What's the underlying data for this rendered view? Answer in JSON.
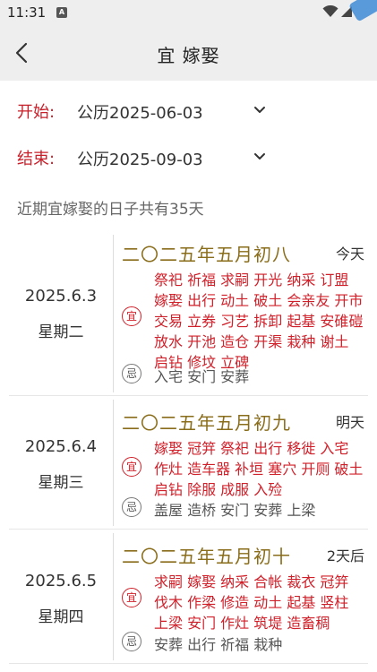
{
  "status_bar": {
    "time": "11:31",
    "notification_glyph": "A"
  },
  "app_bar": {
    "title": "宜 嫁娶"
  },
  "range": {
    "start_label": "开始:",
    "start_value": "公历2025-06-03",
    "end_label": "结束:",
    "end_value": "公历2025-09-03"
  },
  "summary": "近期宜嫁娶的日子共有35天",
  "days": [
    {
      "date": "2025.6.3",
      "weekday": "星期二",
      "lunar": "二〇二五年五月初八",
      "relative": "今天",
      "yi_badge": "宜",
      "yi": "祭祀 祈福 求嗣 开光 纳采 订盟 嫁娶 出行 动土 破土 会亲友 开市 交易 立券 习艺 拆卸 起基 安碓磑 放水 开池 造仓 开渠 栽种 谢土 启钻 修坟 立碑",
      "ji_badge": "忌",
      "ji": "入宅 安门 安葬"
    },
    {
      "date": "2025.6.4",
      "weekday": "星期三",
      "lunar": "二〇二五年五月初九",
      "relative": "明天",
      "yi_badge": "宜",
      "yi": "嫁娶 冠笄 祭祀 出行 移徙 入宅 作灶 造车器 补垣 塞穴 开厕 破土 启钻 除服 成服 入殓",
      "ji_badge": "忌",
      "ji": "盖屋 造桥 安门 安葬 上梁"
    },
    {
      "date": "2025.6.5",
      "weekday": "星期四",
      "lunar": "二〇二五年五月初十",
      "relative": "2天后",
      "yi_badge": "宜",
      "yi": "求嗣 嫁娶 纳采 合帐 裁衣 冠笄 伐木 作梁 修造 动土 起基 竖柱 上梁 安门 作灶 筑堤 造畜稠",
      "ji_badge": "忌",
      "ji": "安葬 出行 祈福 栽种"
    }
  ]
}
